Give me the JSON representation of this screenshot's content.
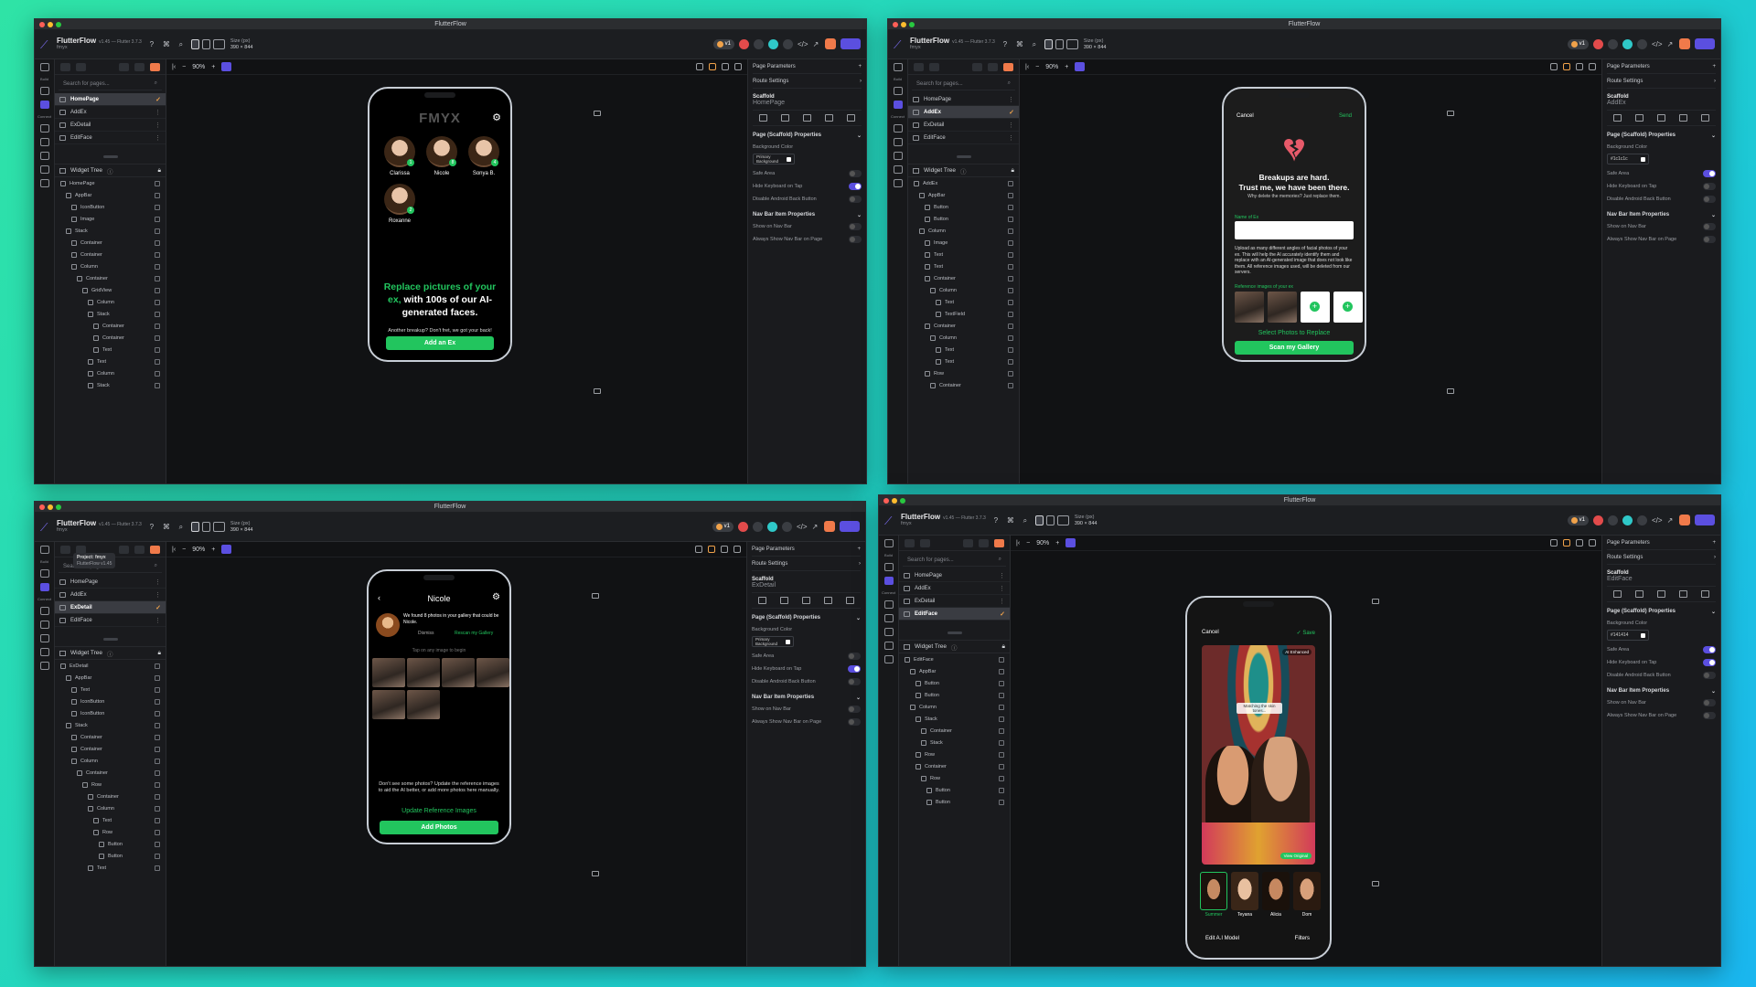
{
  "app": {
    "window_title": "FlutterFlow",
    "name": "FlutterFlow",
    "version": "v1.45 — Flutter 3.7.3",
    "project": "fmyx",
    "size_label": "Size (px)",
    "size_value": "390 × 844",
    "zoom": "90%",
    "version_pill": "v1",
    "tooltip_project": "Project: fmyx",
    "tooltip_version": "FlutterFlow v1.45"
  },
  "colors": {
    "accent": "#5b4fe0",
    "green": "#22c55e",
    "orange": "#f07a4a"
  },
  "rail_labels": {
    "build": "Build",
    "connect": "Connect"
  },
  "left": {
    "search_placeholder": "Search for pages...",
    "pages": [
      "HomePage",
      "AddEx",
      "ExDetail",
      "EditFace"
    ],
    "widget_tree_title": "Widget Tree"
  },
  "right": {
    "page_params": "Page Parameters",
    "route_settings": "Route Settings",
    "scaffold": "Scaffold",
    "props_title": "Page (Scaffold) Properties",
    "bg_color": "Background Color",
    "primary_bg": "Primary Background",
    "safe_area": "Safe Area",
    "hide_kb": "Hide Keyboard on Tap",
    "disable_back": "Disable Android Back Button",
    "nav_props": "Nav Bar Item Properties",
    "show_nav": "Show on Nav Bar",
    "always_nav": "Always Show Nav Bar on Page"
  },
  "windows": [
    {
      "page": "HomePage",
      "selected": 0,
      "bg": "Primary Background",
      "tree": [
        "HomePage",
        "AppBar",
        "IconButton",
        "Image",
        "Stack",
        "Container",
        "Container",
        "Column",
        "Container",
        "GridView",
        "Column",
        "Stack",
        "Container",
        "Container",
        "Text",
        "Text",
        "Column",
        "Stack"
      ],
      "depth": [
        0,
        1,
        2,
        2,
        1,
        2,
        2,
        2,
        3,
        4,
        5,
        5,
        6,
        6,
        6,
        5,
        5,
        5
      ]
    },
    {
      "page": "AddEx",
      "selected": 1,
      "bg": "#1c1c1c",
      "tree": [
        "AddEx",
        "AppBar",
        "Button",
        "Button",
        "Column",
        "Image",
        "Text",
        "Text",
        "Container",
        "Column",
        "Text",
        "TextField",
        "Container",
        "Column",
        "Text",
        "Text",
        "Row",
        "Container"
      ],
      "depth": [
        0,
        1,
        2,
        2,
        1,
        2,
        2,
        2,
        2,
        3,
        4,
        4,
        2,
        3,
        4,
        4,
        2,
        3
      ]
    },
    {
      "page": "ExDetail",
      "selected": 2,
      "bg": "Primary Background",
      "tree": [
        "ExDetail",
        "AppBar",
        "Text",
        "IconButton",
        "IconButton",
        "Stack",
        "Container",
        "Container",
        "Column",
        "Container",
        "Row",
        "Container",
        "Column",
        "Text",
        "Row",
        "Button",
        "Button",
        "Text"
      ],
      "depth": [
        0,
        1,
        2,
        2,
        2,
        1,
        2,
        2,
        2,
        3,
        4,
        5,
        5,
        6,
        6,
        7,
        7,
        5
      ]
    },
    {
      "page": "EditFace",
      "selected": 3,
      "bg": "#141414",
      "tree": [
        "EditFace",
        "AppBar",
        "Button",
        "Button",
        "Column",
        "Stack",
        "Container",
        "Stack",
        "Row",
        "Container",
        "Row",
        "Button",
        "Button"
      ],
      "depth": [
        0,
        1,
        2,
        2,
        1,
        2,
        3,
        3,
        2,
        2,
        3,
        4,
        4
      ]
    }
  ],
  "home": {
    "brand": "FMYX",
    "names": [
      "Clarissa",
      "Nicole",
      "Sonya B.",
      "Roxanne"
    ],
    "headline_green": "Replace pictures of your ex,",
    "headline_rest": "with 100s of our AI-generated faces.",
    "sub": "Another breakup? Don't fret, we got your back!",
    "cta": "Add an Ex"
  },
  "addex": {
    "cancel": "Cancel",
    "send": "Send",
    "title1": "Breakups are hard.",
    "title2": "Trust me, we have been there.",
    "sub": "Why delete the memories? Just replace them.",
    "name_label": "Name of Ex",
    "body": "Upload as many different angles of facial photos of your ex. This will help the AI accurately identify them and replace with an AI-generated image that does not look like them. All reference images used, will be deleted from our servers.",
    "ref_label": "Reference images of your ex",
    "select": "Select Photos to Replace",
    "scan": "Scan my Gallery"
  },
  "exdetail": {
    "title": "Nicole",
    "found": "We found 8 photos in your gallery that could be Nicole.",
    "dismiss": "Dismiss",
    "rescan": "Rescan my Gallery",
    "tap": "Tap on any image to begin",
    "help": "Don't see some photos? Update the reference images to aid the AI better, or add more photos here manually.",
    "update": "Update Reference Images",
    "add": "Add Photos"
  },
  "editface": {
    "cancel": "Cancel",
    "save": "Save",
    "ai_tag": "AI Enhanced",
    "matching": "Matching the skin tones...",
    "view_original": "View Original",
    "faces": [
      "Summer",
      "Teyana",
      "Alicia",
      "Dom"
    ],
    "edit_model": "Edit A.I Model",
    "filters": "Filters"
  }
}
